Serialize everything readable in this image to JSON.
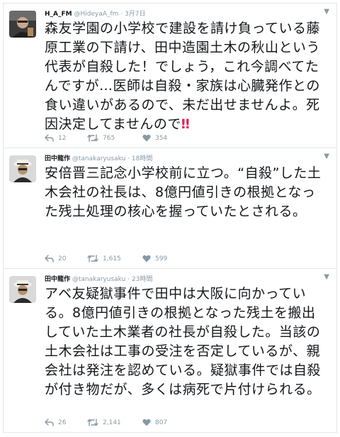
{
  "tweets": [
    {
      "name": "H_A_FM",
      "handle": "@HideyaA_fm",
      "separator": "·",
      "time": "3月7日",
      "text": "森友学園の小学校で建設を請け負っている藤原工業の下請け、田中造園土木の秋山という代表が自殺した！でしょう，これ今調べてたんですが…医師は自殺・家族は心臓発作との食い違いがあるので、未だ出せませんよ。死因決定してませんので",
      "emoji": "‼",
      "replies": "12",
      "retweets": "765",
      "likes": "354"
    },
    {
      "name": "田中龍作",
      "handle": "@tanakaryusaku",
      "separator": "·",
      "time": "18時間",
      "text": "安倍晋三記念小学校前に立つ。“自殺”した土木会社の社長は、8億円値引きの根拠となった残土処理の核心を握っていたとされる。",
      "replies": "20",
      "retweets": "1,615",
      "likes": "599"
    },
    {
      "name": "田中龍作",
      "handle": "@tanakaryusaku",
      "separator": "·",
      "time": "23時間",
      "text": "アベ友疑獄事件で田中は大阪に向かっている。8億円値引きの根拠となった残土を搬出していた土木業者の社長が自殺した。当該の土木会社は工事の受注を否定しているが、親会社は発注を認めている。疑獄事件では自殺が付き物だが、多くは病死で片付けられる。",
      "replies": "26",
      "retweets": "2,141",
      "likes": "807"
    }
  ],
  "icons": {
    "reply": "reply-icon",
    "retweet": "retweet-icon",
    "like": "heart-icon",
    "caret": "chevron-down-icon"
  },
  "colors": {
    "text": "#14171a",
    "muted": "#8899a6",
    "border": "#e1e8ed",
    "emoji": "#e0245e"
  }
}
